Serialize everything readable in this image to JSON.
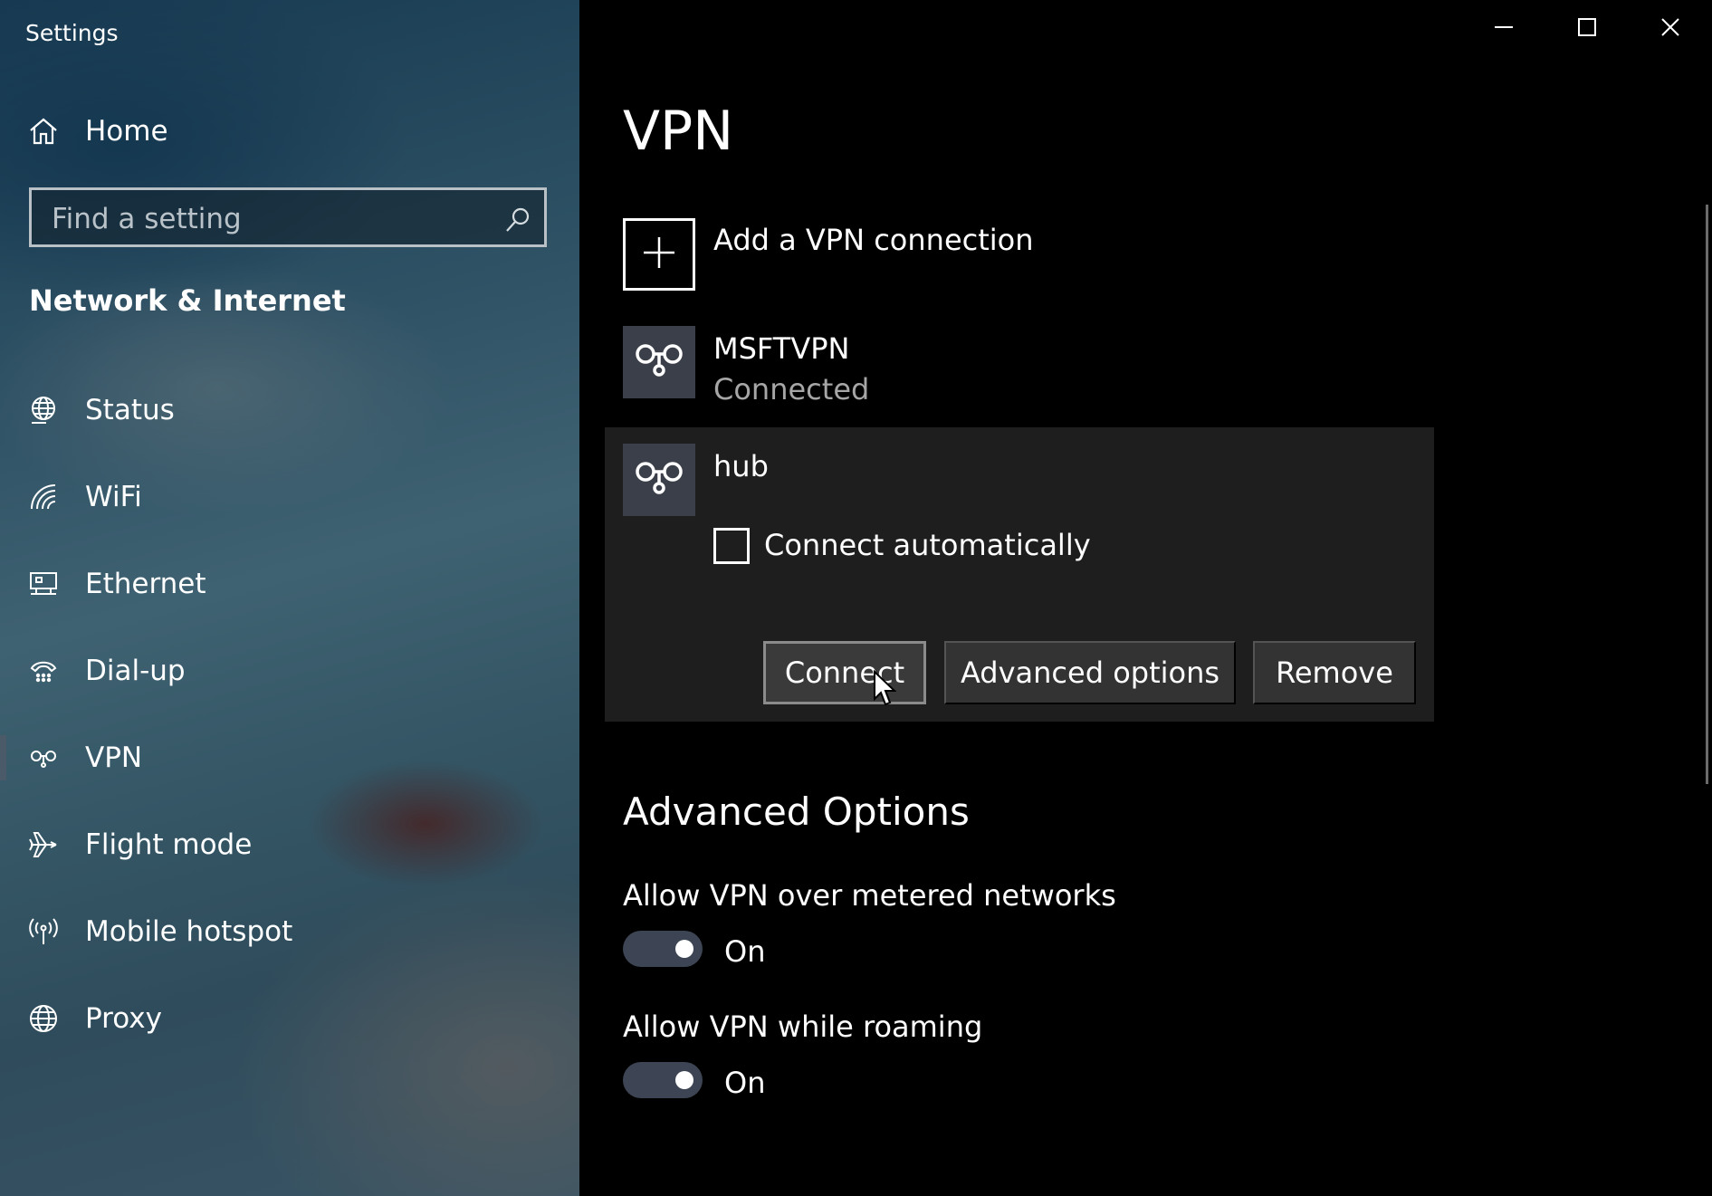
{
  "window": {
    "title": "Settings",
    "controls": {
      "minimize_icon": "minimize-icon",
      "maximize_icon": "maximize-icon",
      "close_icon": "close-icon"
    }
  },
  "sidebar": {
    "home_label": "Home",
    "search": {
      "placeholder": "Find a setting",
      "value": ""
    },
    "section_heading": "Network & Internet",
    "items": [
      {
        "label": "Status",
        "icon": "status-globe-icon"
      },
      {
        "label": "WiFi",
        "icon": "wifi-icon"
      },
      {
        "label": "Ethernet",
        "icon": "ethernet-icon"
      },
      {
        "label": "Dial-up",
        "icon": "dial-up-icon"
      },
      {
        "label": "VPN",
        "icon": "vpn-icon",
        "selected": true
      },
      {
        "label": "Flight mode",
        "icon": "flight-mode-icon"
      },
      {
        "label": "Mobile hotspot",
        "icon": "hotspot-icon"
      },
      {
        "label": "Proxy",
        "icon": "proxy-globe-icon"
      }
    ]
  },
  "main": {
    "title": "VPN",
    "add_connection_label": "Add a VPN connection",
    "connections": [
      {
        "name": "MSFTVPN",
        "status": "Connected"
      },
      {
        "name": "hub",
        "status": ""
      }
    ],
    "hub_panel": {
      "connect_automatically_label": "Connect automatically",
      "connect_automatically_checked": false,
      "buttons": {
        "connect": "Connect",
        "advanced": "Advanced options",
        "remove": "Remove"
      }
    },
    "advanced_options": {
      "heading": "Advanced Options",
      "metered": {
        "label": "Allow VPN over metered networks",
        "state": "On"
      },
      "roaming": {
        "label": "Allow VPN while roaming",
        "state": "On"
      }
    }
  },
  "colors": {
    "main_background": "#000000",
    "panel_background": "#1e1e1e",
    "tile_background": "#3b3f4a",
    "button_background": "#333333",
    "toggle_track": "#3d4554",
    "secondary_text": "#a6a6a6"
  }
}
